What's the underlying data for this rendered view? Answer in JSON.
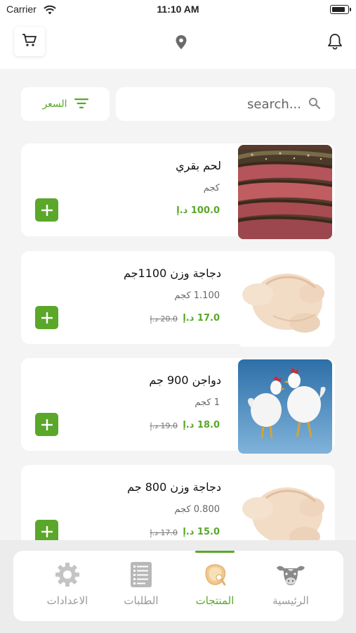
{
  "status_bar": {
    "carrier": "Carrier",
    "time": "11:10 AM",
    "battery_level": 0.9
  },
  "header": {
    "cart_icon": "cart-icon",
    "location_icon": "location-pin-icon",
    "notification_icon": "bell-icon"
  },
  "search": {
    "placeholder": "search...",
    "value": ""
  },
  "filter": {
    "label": "السعر",
    "icon": "filter-lines-icon"
  },
  "products": [
    {
      "name": "لحم بقري",
      "weight": "كجم",
      "price": "100.0 د.إ",
      "old_price": "",
      "image": "roast-beef"
    },
    {
      "name": "دجاجة وزن 1100جم",
      "weight": "1.100 كجم",
      "price": "17.0 د.إ",
      "old_price": "20.0 د.إ",
      "image": "raw-chicken"
    },
    {
      "name": "دواجن 900 جم",
      "weight": "1 كجم",
      "price": "18.0 د.إ",
      "old_price": "19.0 د.إ",
      "image": "live-chickens"
    },
    {
      "name": "دجاجة وزن 800 جم",
      "weight": "0.800 كجم",
      "price": "15.0 د.إ",
      "old_price": "17.0 د.إ",
      "image": "raw-chicken"
    }
  ],
  "tabs": [
    {
      "label": "الرئيسية",
      "icon": "cow-icon",
      "active": false
    },
    {
      "label": "المنتجات",
      "icon": "meat-icon",
      "active": true
    },
    {
      "label": "الطلبات",
      "icon": "orders-list-icon",
      "active": false
    },
    {
      "label": "الاعدادات",
      "icon": "gear-icon",
      "active": false
    }
  ],
  "colors": {
    "accent": "#5aa72a",
    "background": "#f4f4f4",
    "card": "#ffffff",
    "inactive_tab": "#999999"
  }
}
